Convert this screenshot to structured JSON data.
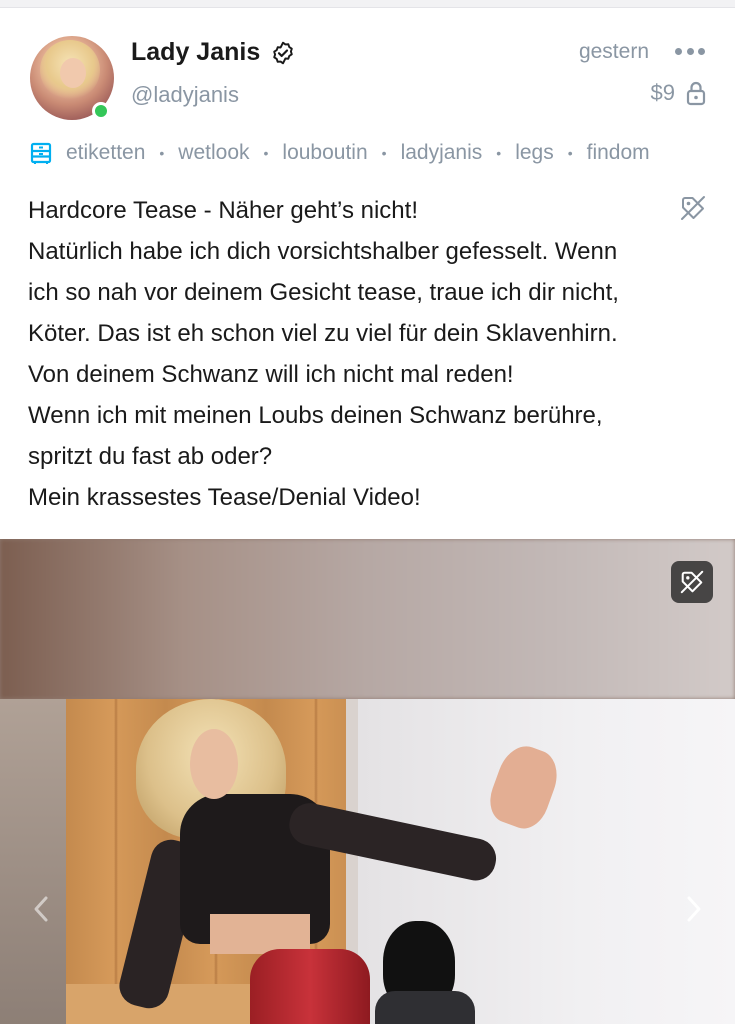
{
  "post": {
    "author": {
      "display_name": "Lady Janis",
      "handle": "@ladyjanis",
      "verified": true,
      "online": true,
      "online_color": "#34c759"
    },
    "time": "gestern",
    "price": "$9",
    "tags_icon": "tag-list-icon",
    "tags": [
      "etiketten",
      "wetlook",
      "louboutin",
      "ladyjanis",
      "legs",
      "findom"
    ],
    "text_lines": [
      "Hardcore Tease - Näher geht’s nicht!",
      "Natürlich habe ich dich vorsichtshalber gefesselt. Wenn",
      "ich so nah vor deinem Gesicht tease, traue ich dir nicht,",
      "Köter. Das ist eh schon viel zu viel für dein Sklavenhirn.",
      "Von deinem Schwanz will ich nicht mal reden!",
      "Wenn ich mit meinen Loubs deinen Schwanz berühre,",
      "spritzt du fast ab oder?",
      "Mein krassestes Tease/Denial Video!"
    ]
  },
  "colors": {
    "accent": "#00aff0",
    "muted": "#8a96a3",
    "text": "#1a1a1a"
  },
  "icons": {
    "verified": "verified-badge-icon",
    "more": "more-options-icon",
    "lock": "lock-icon",
    "hide": "eye-off-tag-icon",
    "prev": "chevron-left-icon",
    "next": "chevron-right-icon"
  }
}
